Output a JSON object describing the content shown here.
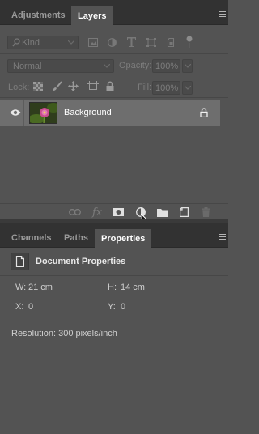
{
  "layers_panel": {
    "tabs": [
      "Adjustments",
      "Layers"
    ],
    "filter_kind": "Kind",
    "blend_mode": "Normal",
    "opacity_label": "Opacity:",
    "opacity_value": "100%",
    "lock_label": "Lock:",
    "fill_label": "Fill:",
    "fill_value": "100%",
    "layer": {
      "name": "Background",
      "visible": true,
      "locked": true
    },
    "footer_fx": "fx"
  },
  "lower_panel": {
    "tabs": [
      "Channels",
      "Paths",
      "Properties"
    ],
    "heading": "Document Properties",
    "width_label": "W:",
    "width_value": "21 cm",
    "height_label": "H:",
    "height_value": "14 cm",
    "x_label": "X:",
    "x_value": "0",
    "y_label": "Y:",
    "y_value": "0",
    "resolution": "Resolution: 300 pixels/inch"
  },
  "colors": {
    "panel": "#535353",
    "tabbar": "#323232",
    "selected_layer": "#6e6e6e",
    "thumbnail_flower": "#d65a9e"
  }
}
